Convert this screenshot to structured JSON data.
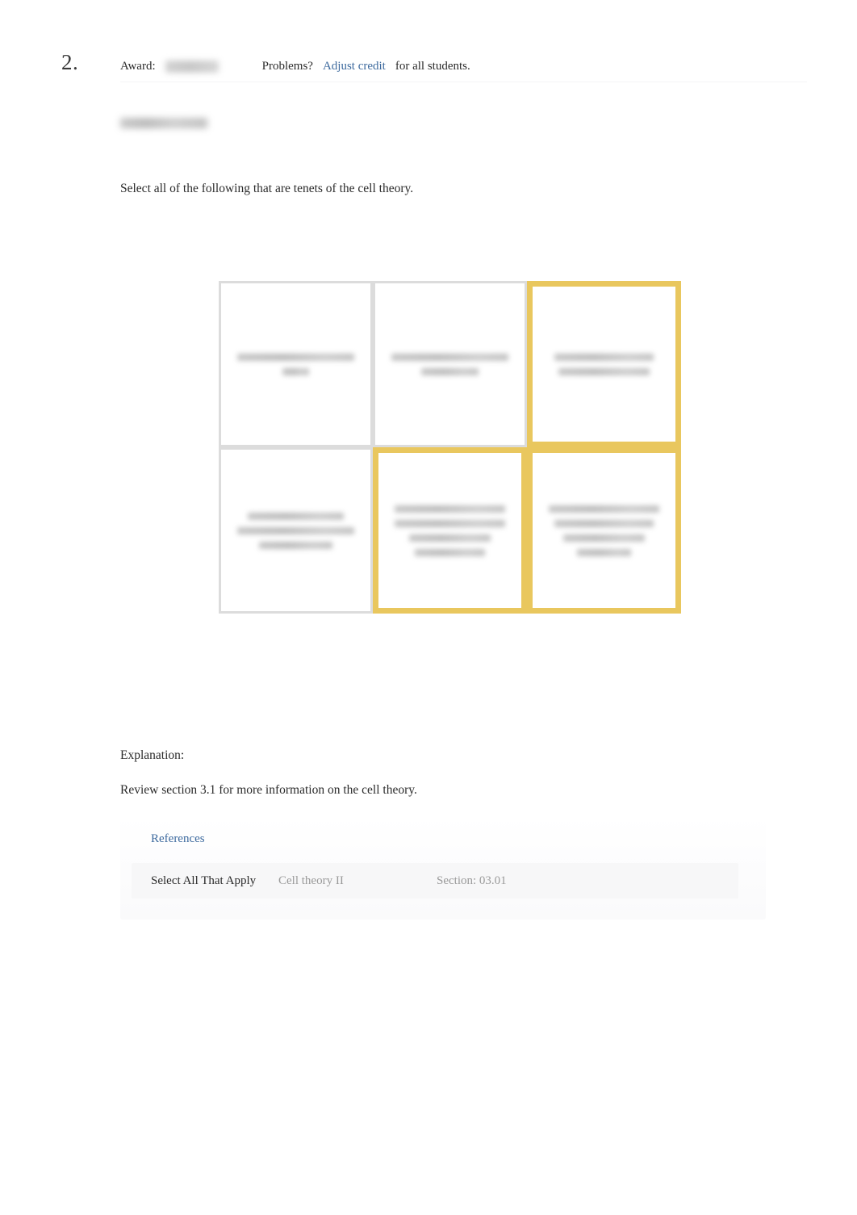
{
  "header": {
    "question_number": "2.",
    "award_label": "Award:",
    "award_value_redacted": "",
    "problems_label": "Problems?",
    "adjust_credit_link": "Adjust credit",
    "for_all_students": "for all students."
  },
  "question": {
    "title_redacted": "",
    "prompt": "Select all of the following that are tenets of the cell theory."
  },
  "options": {
    "grid": {
      "rows": 2,
      "columns": 3,
      "selected_color": "#e9c75e",
      "unselected_color": "#dcdcdc"
    },
    "cells": [
      {
        "index": 1,
        "selected": false,
        "text_redacted": "",
        "line_widths": [
          "w95",
          "w22"
        ]
      },
      {
        "index": 2,
        "selected": false,
        "text_redacted": "",
        "line_widths": [
          "w95",
          "w46"
        ]
      },
      {
        "index": 3,
        "selected": true,
        "text_redacted": "",
        "line_widths": [
          "w85",
          "w78"
        ]
      },
      {
        "index": 4,
        "selected": false,
        "text_redacted": "",
        "line_widths": [
          "w78",
          "w95",
          "w60"
        ]
      },
      {
        "index": 5,
        "selected": true,
        "text_redacted": "",
        "line_widths": [
          "w95",
          "w95",
          "w70",
          "w60"
        ]
      },
      {
        "index": 6,
        "selected": true,
        "text_redacted": "",
        "line_widths": [
          "w95",
          "w85",
          "w70",
          "w46"
        ]
      }
    ]
  },
  "explanation": {
    "label": "Explanation:",
    "body": "Review section 3.1 for more information on the cell theory."
  },
  "references": {
    "link_label": "References",
    "tags": {
      "question_type": "Select All That Apply",
      "topic": "Cell theory II",
      "section": "Section: 03.01"
    }
  }
}
